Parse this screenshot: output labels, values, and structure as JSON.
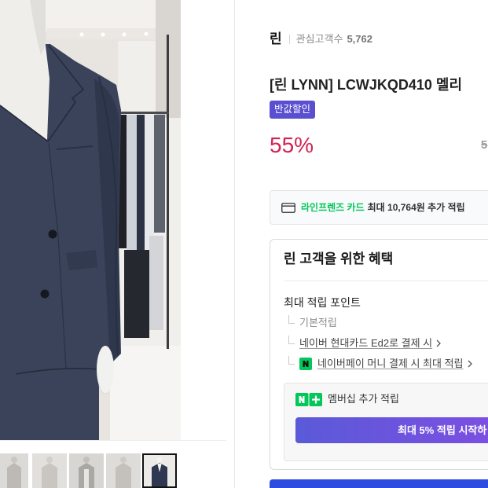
{
  "colors": {
    "badge_purple": "#5b4fd1",
    "discount_red": "#d22352",
    "naver_green": "#03c75a",
    "membership_start": "#5a5ad8",
    "membership_end": "#7b4fe2",
    "buy_blue": "#2f4ce0"
  },
  "gallery": {
    "thumbnails": [
      {
        "selected": false
      },
      {
        "selected": false
      },
      {
        "selected": false
      },
      {
        "selected": false
      },
      {
        "selected": true
      }
    ]
  },
  "store": {
    "name": "린",
    "interest_label": "관심고객수",
    "interest_count": "5,762"
  },
  "product": {
    "title": "[린 LYNN] LCWJKQD410 멜리",
    "badge": "반값할인",
    "discount_rate": "55%",
    "original_price": "5"
  },
  "card_promo": {
    "icon": "credit-card-icon",
    "card_name": "라인프렌즈 카드",
    "benefit": "최대 10,764원 추가 적립"
  },
  "benefits": {
    "title": "린 고객을 위한 혜택",
    "max_points_label": "최대 적립 포인트",
    "items": [
      {
        "label": "기본적립"
      },
      {
        "label": "네이버 현대카드 Ed2로 결제 시",
        "icon": "chevron-right-icon"
      },
      {
        "label": "네이버페이 머니 결제 시 최대 적립",
        "icon": "naverpay-n-icon"
      }
    ],
    "membership": {
      "icon": "naver-plus-membership-icon",
      "label": "멤버십 추가 적립",
      "button_label": "최대 5% 적립 시작하"
    }
  }
}
